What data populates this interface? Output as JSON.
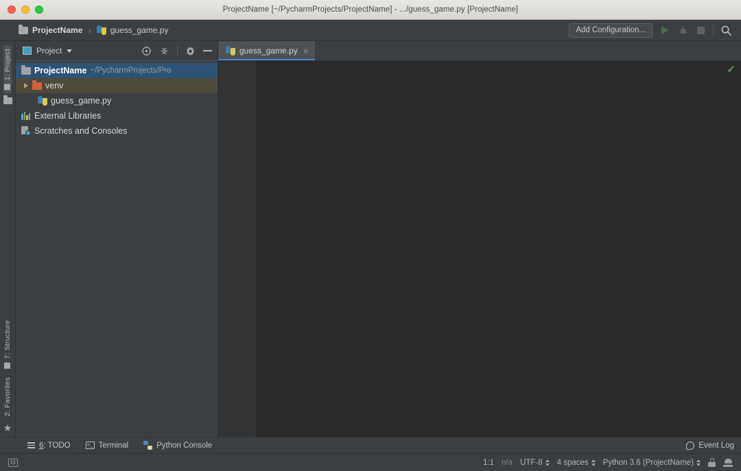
{
  "window": {
    "title": "ProjectName [~/PycharmProjects/ProjectName] - .../guess_game.py [ProjectName]",
    "traffic_lights": [
      "close",
      "minimize",
      "maximize"
    ]
  },
  "navbar": {
    "breadcrumb": [
      {
        "label": "ProjectName",
        "icon": "folder-icon"
      },
      {
        "label": "guess_game.py",
        "icon": "python-file-icon"
      }
    ],
    "separator": "›",
    "add_configuration_label": "Add Configuration...",
    "actions": [
      {
        "name": "run-button",
        "icon": "run-triangle-icon"
      },
      {
        "name": "debug-button",
        "icon": "bug-icon"
      },
      {
        "name": "stop-button",
        "icon": "stop-square-icon"
      },
      {
        "name": "search-everywhere-button",
        "icon": "search-icon"
      }
    ]
  },
  "left_strip": {
    "top_tabs": [
      {
        "label": "1: Project",
        "active": true
      }
    ],
    "bottom_tabs": [
      {
        "label": "7: Structure",
        "active": false
      },
      {
        "label": "2: Favorites",
        "active": false
      }
    ]
  },
  "project_panel": {
    "title": "Project",
    "header_icons": [
      {
        "name": "select-opened-file-icon"
      },
      {
        "name": "collapse-all-icon"
      },
      {
        "name": "settings-gear-icon"
      },
      {
        "name": "hide-panel-icon"
      }
    ],
    "tree": [
      {
        "label": "ProjectName",
        "detail": "~/PycharmProjects/Pro",
        "icon": "folder-icon",
        "indent": 0,
        "bold": true,
        "selected": true,
        "expander": "none"
      },
      {
        "label": "venv",
        "detail": "",
        "icon": "folder-excluded-icon",
        "indent": 1,
        "bold": false,
        "selected": false,
        "highlighted": true,
        "expander": "collapsed"
      },
      {
        "label": "guess_game.py",
        "detail": "",
        "icon": "python-file-icon",
        "indent": 2,
        "bold": false,
        "selected": false,
        "expander": "none"
      },
      {
        "label": "External Libraries",
        "detail": "",
        "icon": "libraries-icon",
        "indent": 0,
        "bold": false,
        "selected": false,
        "expander": "none"
      },
      {
        "label": "Scratches and Consoles",
        "detail": "",
        "icon": "scratches-icon",
        "indent": 0,
        "bold": false,
        "selected": false,
        "expander": "none"
      }
    ]
  },
  "editor": {
    "tabs": [
      {
        "label": "guess_game.py",
        "icon": "python-file-icon",
        "close": "×",
        "active": true
      }
    ],
    "content": "",
    "inspection_status": "✓"
  },
  "tool_windows": {
    "left_items": [
      {
        "label_prefix": "6",
        "label": ": TODO",
        "icon": "todo-list-icon"
      },
      {
        "label_prefix": "",
        "label": "Terminal",
        "icon": "terminal-icon"
      },
      {
        "label_prefix": "",
        "label": "Python Console",
        "icon": "python-console-icon"
      }
    ],
    "right_items": [
      {
        "label": "Event Log",
        "icon": "event-log-icon"
      }
    ]
  },
  "status_bar": {
    "left_icon": "monitor-icon",
    "caret_position": "1:1",
    "git_branch": "n/a",
    "encoding": "UTF-8",
    "indent": "4 spaces",
    "interpreter": "Python 3.6 (ProjectName)",
    "lock_icon": "unlocked-icon",
    "inspector_icon": "inspector-icon"
  },
  "colors": {
    "editor_bg": "#2b2b2b",
    "panel_bg": "#3c3f41",
    "selection_blue": "#2f5373",
    "highlight_olive": "#4e4a3b",
    "tab_underline": "#4a88c7",
    "ok_green": "#5a9e5a",
    "folder_orange": "#d4603a"
  }
}
